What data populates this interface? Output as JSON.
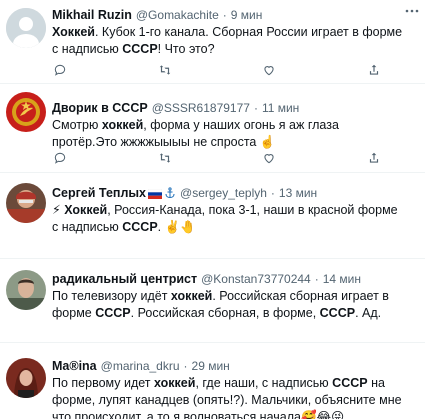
{
  "tweets": [
    {
      "name": "Mikhail Ruzin",
      "handle": "@Gomakachite",
      "sep": "·",
      "time": "9 мин",
      "text_parts": [
        "Хоккей",
        ". Кубок 1-го канала. Сборная России играет в форме с надписью ",
        "СССР",
        "! Что это?"
      ]
    },
    {
      "name": "Дворик в СССР",
      "handle": "@SSSR61879177",
      "sep": "·",
      "time": "11 мин",
      "text_parts": [
        "Смотрю ",
        "хоккей",
        ", форма у наших огонь я аж глаза протёр.Это жжжжыыыы не спроста ☝️"
      ]
    },
    {
      "name": "Сергей Теплых",
      "handle": "@sergey_teplyh",
      "sep": "·",
      "time": "13 мин",
      "text_parts": [
        "⚡ ",
        "Хоккей",
        ", Россия-Канада, пока 3-1, наши в красной форме с надписью ",
        "СССР",
        ". ✌️🤚"
      ]
    },
    {
      "name": "радикальный центрист",
      "handle": "@Konstan73770244",
      "sep": "·",
      "time": "14 мин",
      "text_parts": [
        "По телевизору идёт ",
        "хоккей",
        ". Российская сборная играет в форме ",
        "СССР",
        ". Российская сборная, в форме, ",
        "СССР",
        ". Ад."
      ]
    },
    {
      "name": "Ma®ina",
      "handle": "@marina_dkru",
      "sep": "·",
      "time": "29 мин",
      "text_parts": [
        "По первому идет ",
        "хоккей",
        ", где наши, с надписью ",
        "СССР",
        " на форме, лупят канадцев (опять!?). Мальчики, объясните мне что происходит, а то я волноваться начала🥰😂😜"
      ]
    }
  ],
  "icons": [
    "reply-icon",
    "retweet-icon",
    "like-icon",
    "share-icon",
    "more-icon",
    "anchor-icon",
    "russia-flag-icon"
  ],
  "colors": {
    "text": "#0f1419",
    "secondary": "#536471",
    "divider": "#eff3f4"
  }
}
